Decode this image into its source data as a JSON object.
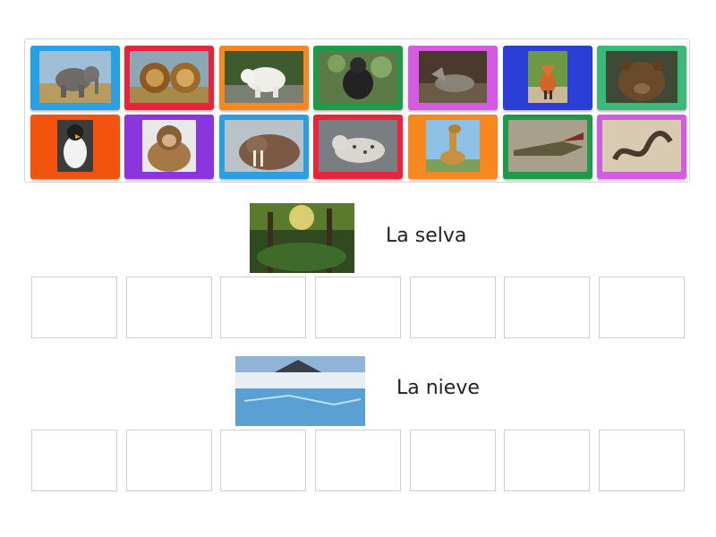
{
  "bank": {
    "tiles": [
      {
        "animal": "elephant",
        "frame_color": "#2aa0e2"
      },
      {
        "animal": "lion",
        "frame_color": "#e8243c"
      },
      {
        "animal": "polar-bear",
        "frame_color": "#f7871f"
      },
      {
        "animal": "gorilla",
        "frame_color": "#1e9a4a"
      },
      {
        "animal": "wolf",
        "frame_color": "#d25be0"
      },
      {
        "animal": "fox",
        "frame_color": "#2a3fd6"
      },
      {
        "animal": "brown-bear",
        "frame_color": "#3cb878"
      },
      {
        "animal": "penguin",
        "frame_color": "#f2540f"
      },
      {
        "animal": "monkey",
        "frame_color": "#8b35e0"
      },
      {
        "animal": "walrus",
        "frame_color": "#2aa0e2"
      },
      {
        "animal": "snow-leopard",
        "frame_color": "#e8243c"
      },
      {
        "animal": "giraffe",
        "frame_color": "#f7871f"
      },
      {
        "animal": "crocodile",
        "frame_color": "#1e9a4a"
      },
      {
        "animal": "snake",
        "frame_color": "#d25be0"
      }
    ]
  },
  "categories": [
    {
      "label": "La selva",
      "image": "jungle",
      "slots": 7
    },
    {
      "label": "La nieve",
      "image": "glacier",
      "slots": 7
    }
  ]
}
